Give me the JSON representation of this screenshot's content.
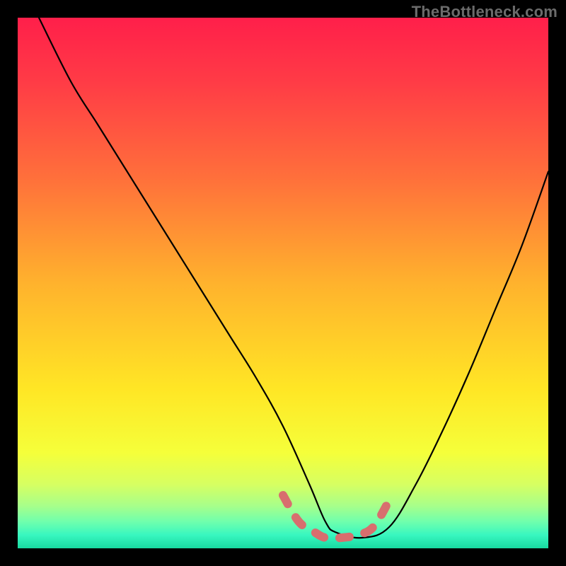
{
  "watermark": "TheBottleneck.com",
  "colors": {
    "black": "#000000",
    "curve_stroke": "#000000",
    "dash_stroke": "#d86e6e",
    "gradient_stops": [
      {
        "offset": 0.0,
        "color": "#ff1f4a"
      },
      {
        "offset": 0.12,
        "color": "#ff3b46"
      },
      {
        "offset": 0.3,
        "color": "#ff6f3b"
      },
      {
        "offset": 0.5,
        "color": "#ffb22d"
      },
      {
        "offset": 0.7,
        "color": "#ffe625"
      },
      {
        "offset": 0.82,
        "color": "#f5ff3a"
      },
      {
        "offset": 0.88,
        "color": "#d6ff62"
      },
      {
        "offset": 0.92,
        "color": "#a7ff8a"
      },
      {
        "offset": 0.95,
        "color": "#6fffad"
      },
      {
        "offset": 0.975,
        "color": "#38f7c0"
      },
      {
        "offset": 1.0,
        "color": "#18d9a0"
      }
    ]
  },
  "chart_data": {
    "type": "line",
    "title": "",
    "xlabel": "",
    "ylabel": "",
    "xlim": [
      0,
      100
    ],
    "ylim": [
      0,
      100
    ],
    "series": [
      {
        "name": "bottleneck-curve",
        "x": [
          4,
          10,
          15,
          20,
          25,
          30,
          35,
          40,
          45,
          50,
          55,
          58,
          60,
          65,
          70,
          75,
          80,
          85,
          90,
          95,
          100
        ],
        "values": [
          100,
          88,
          80,
          72,
          64,
          56,
          48,
          40,
          32,
          23,
          12,
          5,
          3,
          2,
          4,
          12,
          22,
          33,
          45,
          57,
          71
        ]
      }
    ],
    "annotations": [
      {
        "name": "valley-dash",
        "type": "dashed",
        "x": [
          50,
          53,
          56,
          58,
          61,
          64,
          67,
          70
        ],
        "values": [
          10,
          5,
          3,
          2,
          2,
          2.5,
          4,
          9
        ]
      }
    ]
  }
}
